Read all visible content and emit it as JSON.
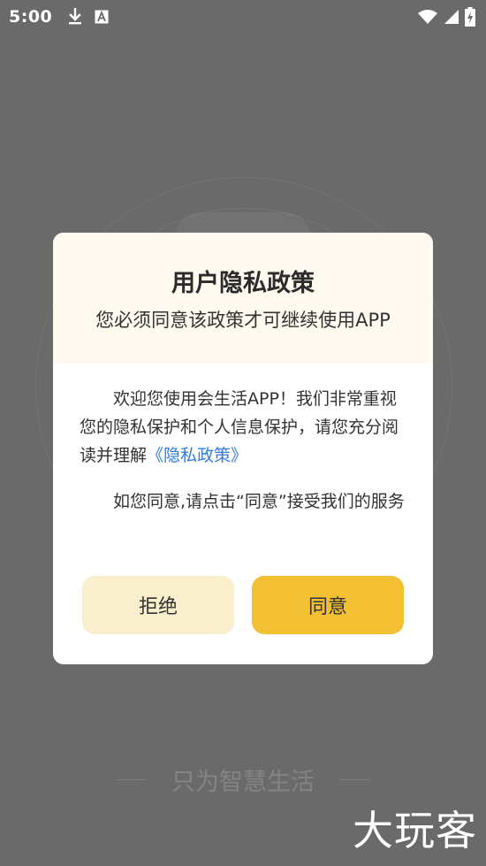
{
  "status_bar": {
    "time": "5:00",
    "left_icons": [
      "download-icon",
      "font-a-icon"
    ],
    "right_icons": [
      "wifi-icon",
      "signal-icon",
      "battery-charging-icon"
    ]
  },
  "dialog": {
    "title": "用户隐私政策",
    "subtitle": "您必须同意该政策才可继续使用APP",
    "paragraph1_text": "欢迎您使用会生活APP！我们非常重视您的隐私保护和个人信息保护，请您充分阅读并理解",
    "policy_link": "《隐私政策》",
    "paragraph2_text": "如您同意,请点击“同意”接受我们的服务",
    "refuse_label": "拒绝",
    "agree_label": "同意"
  },
  "background": {
    "slogan": "只为智慧生活"
  },
  "watermark": "大玩客",
  "colors": {
    "overlay": "#6a6a6a",
    "header_bg": "#fffaf0",
    "link": "#2f7be0",
    "refuse_bg": "#f9efcc",
    "agree_bg": "#f4c033"
  }
}
